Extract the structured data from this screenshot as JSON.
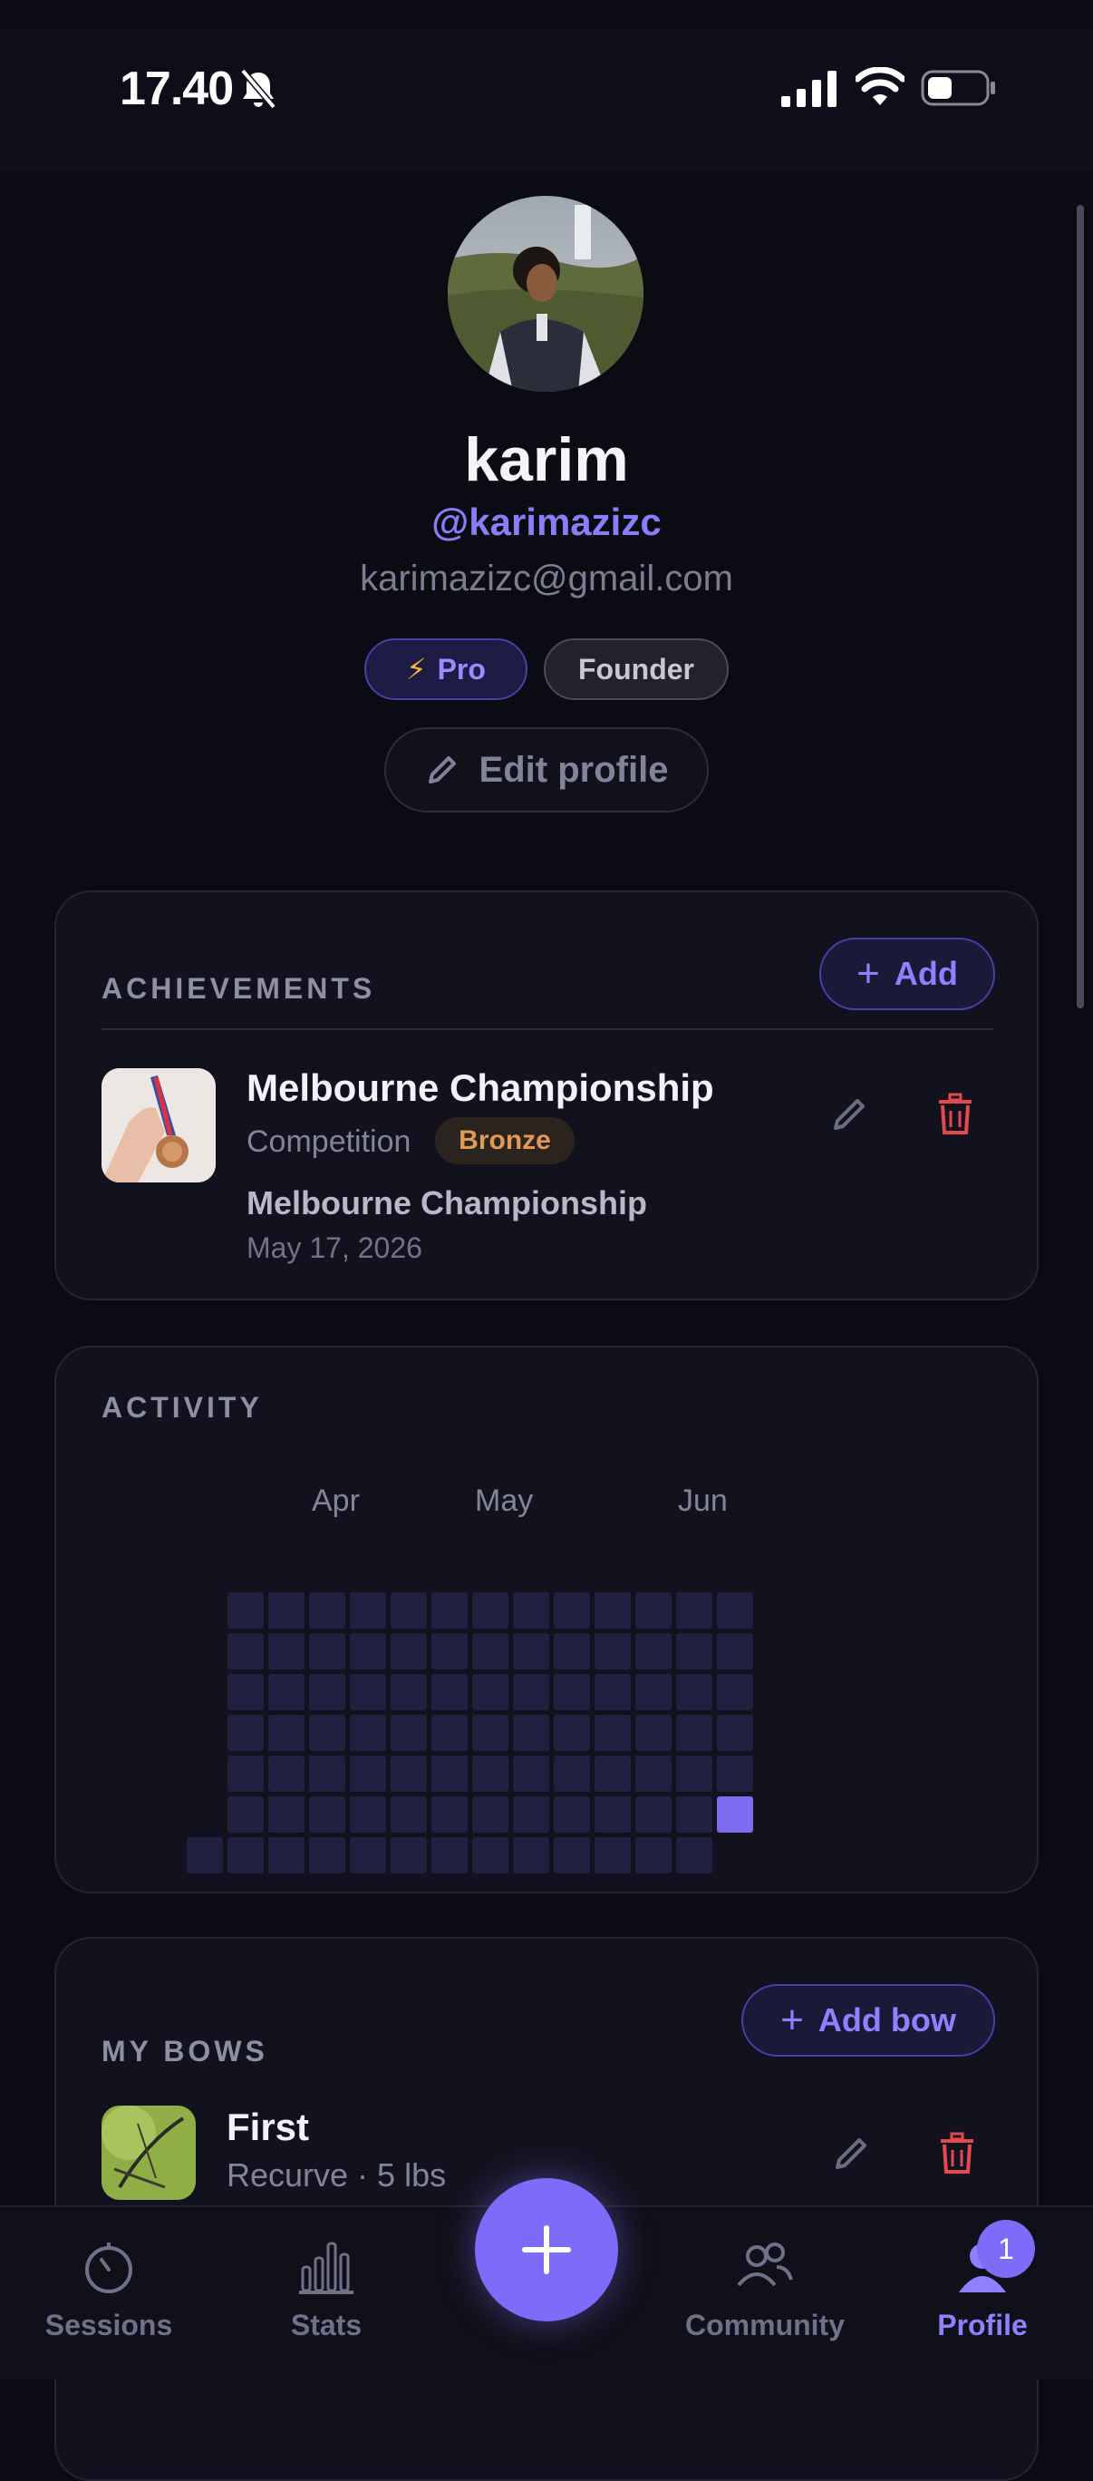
{
  "status_bar": {
    "time": "17.40"
  },
  "profile": {
    "name": "karim",
    "handle": "@karimazizc",
    "email": "karimazizc@gmail.com",
    "badges": [
      "Pro",
      "Founder"
    ],
    "edit_label": "Edit profile"
  },
  "achievements": {
    "title": "ACHIEVEMENTS",
    "add_label": "Add",
    "items": [
      {
        "title": "Melbourne Championship",
        "type": "Competition",
        "tier": "Bronze",
        "event": "Melbourne Championship",
        "date": "May 17, 2026"
      }
    ]
  },
  "activity": {
    "title": "ACTIVITY",
    "months": [
      "Apr",
      "May",
      "Jun"
    ],
    "active_days": 1
  },
  "bows": {
    "title": "MY BOWS",
    "add_label": "Add bow",
    "items": [
      {
        "name": "First",
        "subtitle": "Recurve · 5 lbs"
      }
    ]
  },
  "tabbar": {
    "items": [
      "Sessions",
      "Stats",
      "Community",
      "Profile"
    ],
    "active": "Profile",
    "profile_badge": "1"
  },
  "colors": {
    "accent": "#7e6cf8",
    "background": "#0b0b14",
    "card": "#12121e",
    "bronze": "#e09a56",
    "danger": "#e5484d"
  }
}
